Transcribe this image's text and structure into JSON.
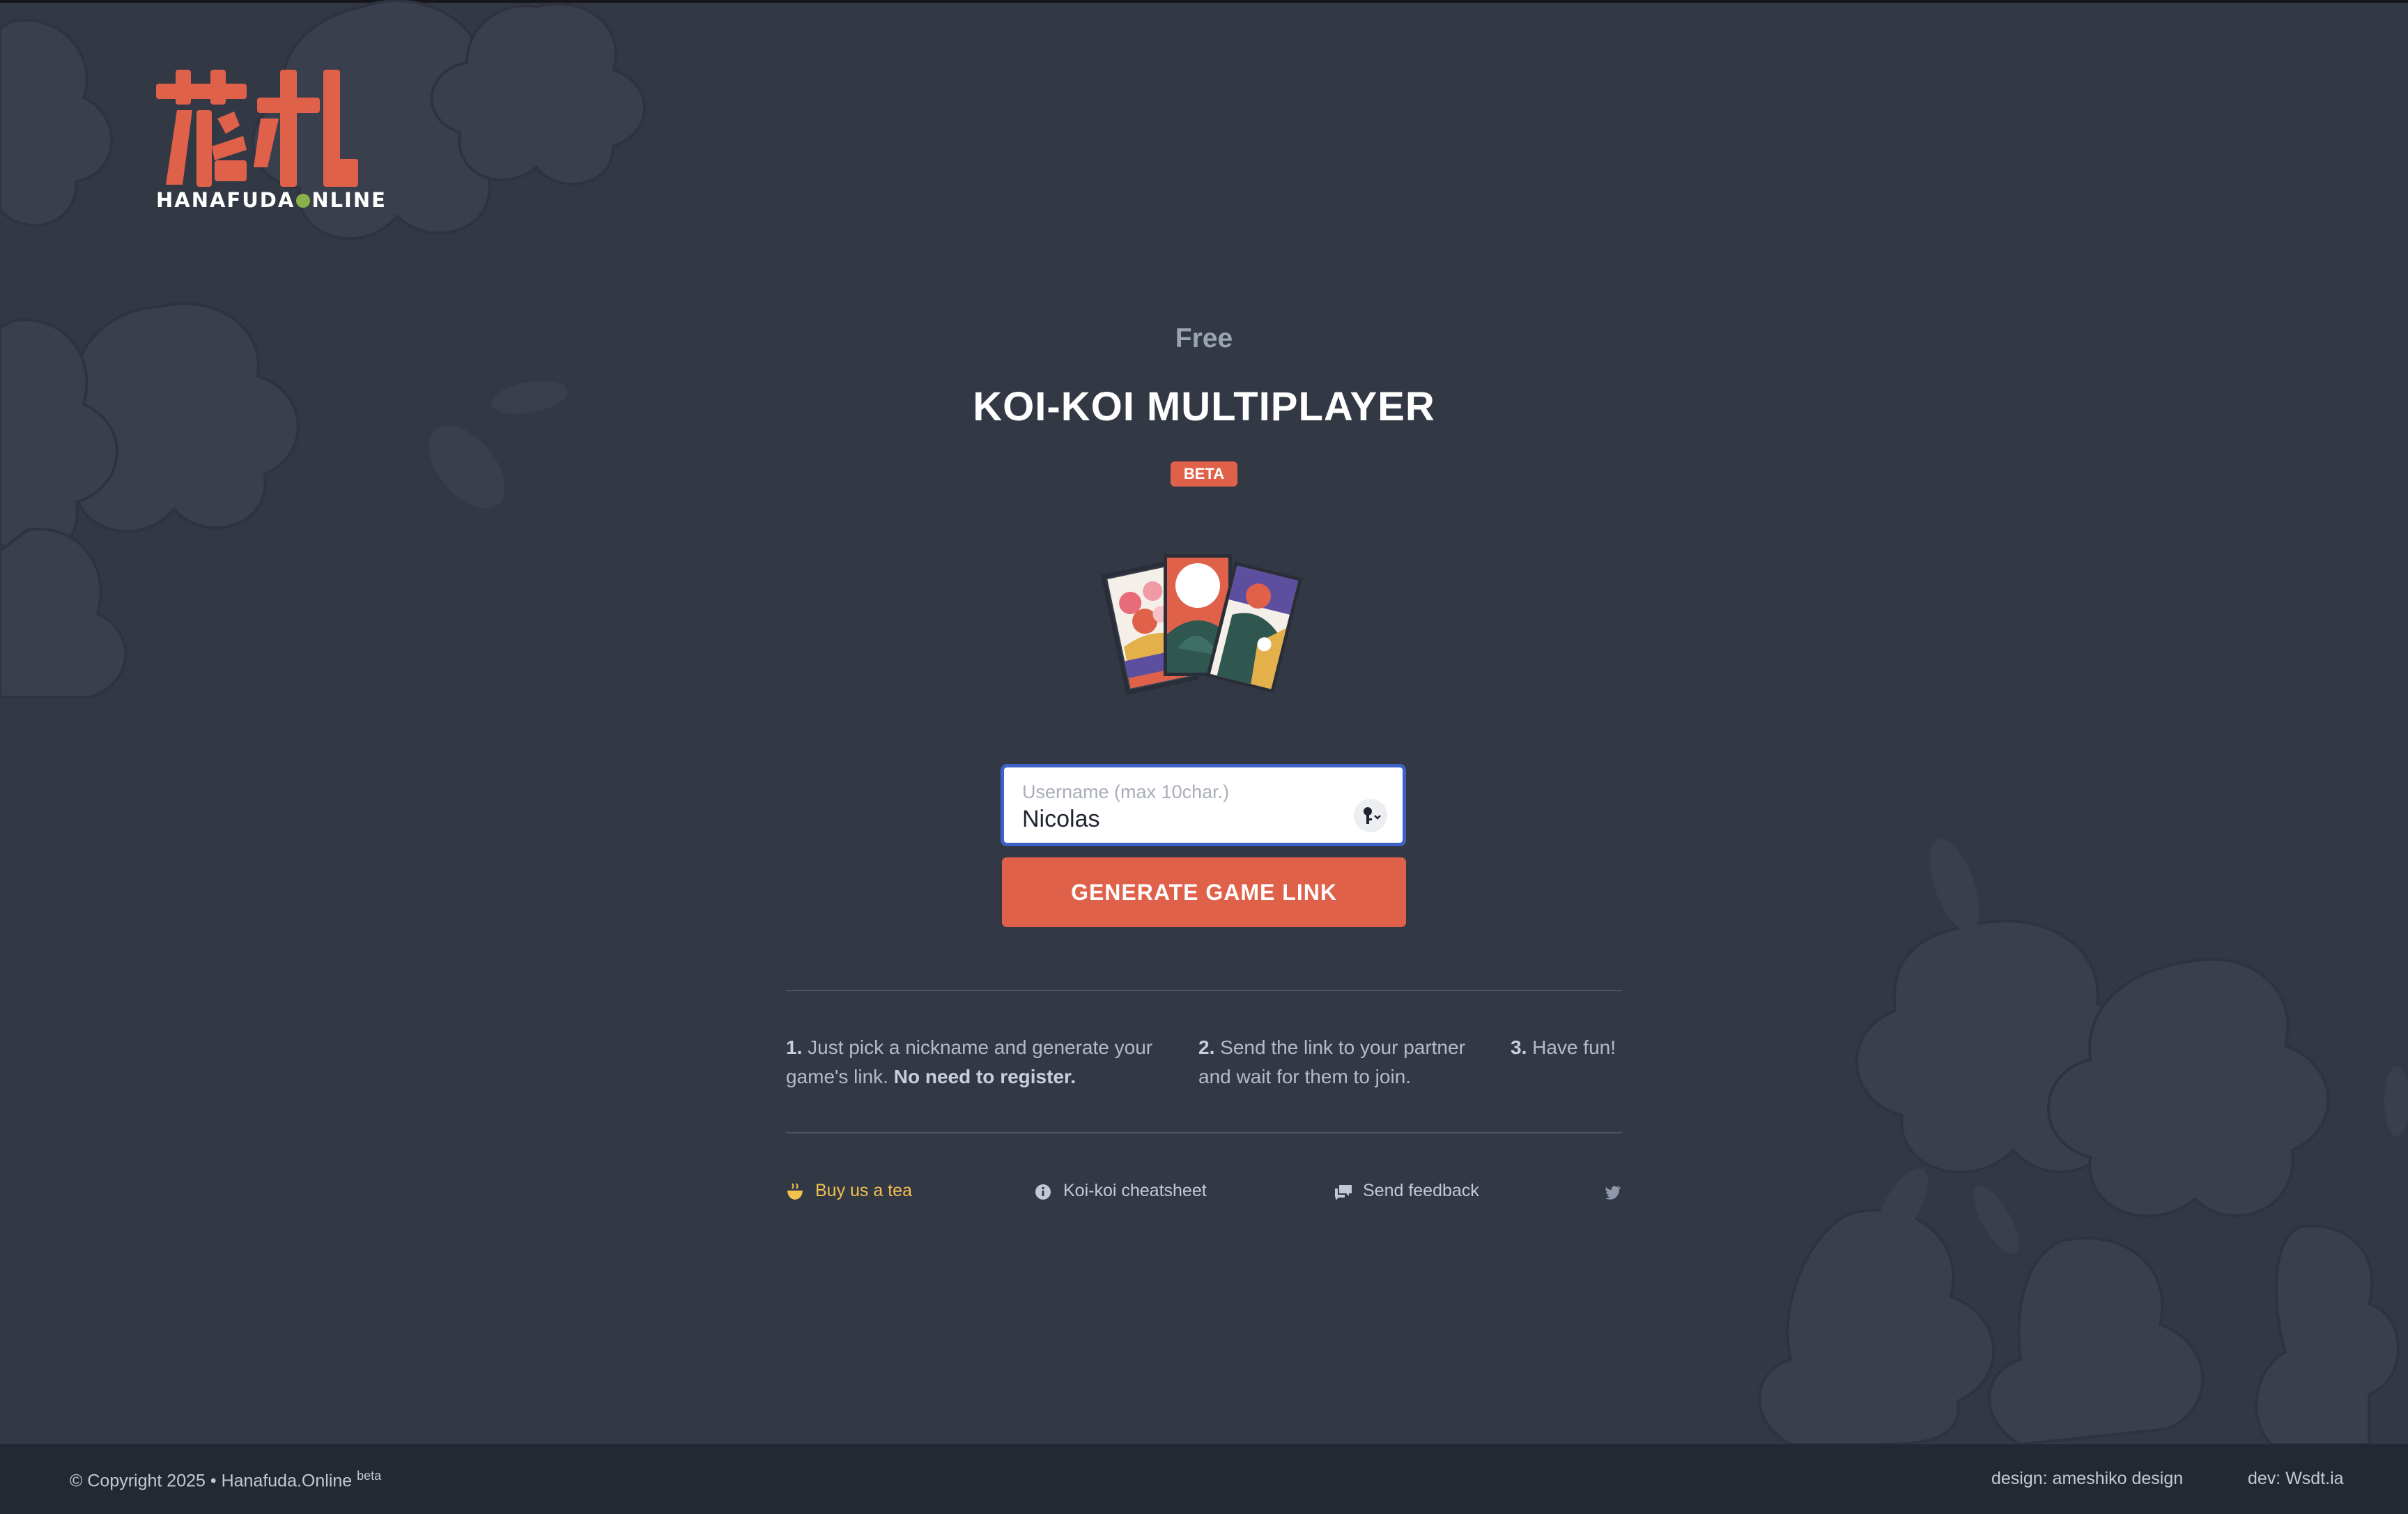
{
  "colors": {
    "background": "#333845",
    "accent": "#e0614a",
    "logo_dot": "#8ab04a",
    "tea_link": "#f2c14f",
    "input_focus": "#3d63c9",
    "footer_bg": "#242833"
  },
  "logo": {
    "kanji": "花札",
    "name_left": "HANAFUDA",
    "name_right": "NLINE"
  },
  "hero": {
    "subtitle": "Free",
    "title": "KOI-KOI MULTIPLAYER",
    "badge": "BETA"
  },
  "form": {
    "username_label": "Username (max 10char.)",
    "username_value": "Nicolas",
    "password_manager_icon": "key-icon",
    "generate_button": "GENERATE GAME LINK"
  },
  "steps": [
    {
      "num": "1.",
      "text": "Just pick a nickname and generate your game's link.",
      "bold": "No need to register."
    },
    {
      "num": "2.",
      "text": "Send the link to your partner and wait for them to join.",
      "bold": ""
    },
    {
      "num": "3.",
      "text": "Have fun!",
      "bold": ""
    }
  ],
  "links": {
    "tea": {
      "label": "Buy us a tea",
      "icon": "tea-bowl-icon"
    },
    "cheatsheet": {
      "label": "Koi-koi cheatsheet",
      "icon": "info-icon"
    },
    "feedback": {
      "label": "Send feedback",
      "icon": "chat-icon"
    },
    "twitter": {
      "icon": "twitter-icon"
    }
  },
  "footer": {
    "copyright": "© Copyright 2025 • Hanafuda.Online",
    "copyright_sup": "beta",
    "design": "design: ameshiko design",
    "dev": "dev: Wsdt.ia"
  }
}
